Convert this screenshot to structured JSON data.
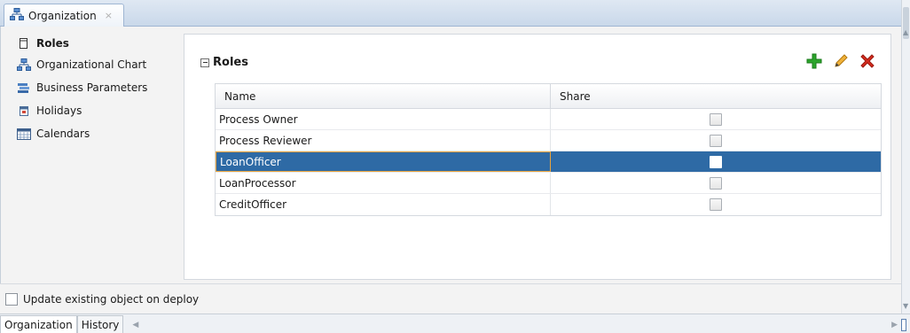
{
  "document_tab": {
    "label": "Organization",
    "close": "×"
  },
  "nav": {
    "items": [
      {
        "label": "Roles",
        "icon": "roles-icon",
        "active": true
      },
      {
        "label": "Organizational Chart",
        "icon": "org-chart-icon"
      },
      {
        "label": "Business Parameters",
        "icon": "business-parameters-icon"
      },
      {
        "label": "Holidays",
        "icon": "holidays-icon"
      },
      {
        "label": "Calendars",
        "icon": "calendars-icon"
      }
    ]
  },
  "section": {
    "title": "Roles",
    "actions": [
      {
        "name": "add",
        "icon": "plus-icon"
      },
      {
        "name": "edit",
        "icon": "pencil-icon"
      },
      {
        "name": "delete",
        "icon": "delete-x-icon"
      }
    ]
  },
  "table": {
    "columns": [
      "Name",
      "Share"
    ],
    "rows": [
      {
        "name": "Process Owner",
        "share": false
      },
      {
        "name": "Process Reviewer",
        "share": false
      },
      {
        "name": "LoanOfficer",
        "share": false,
        "selected": true
      },
      {
        "name": "LoanProcessor",
        "share": false
      },
      {
        "name": "CreditOfficer",
        "share": false
      }
    ]
  },
  "deploy": {
    "label": "Update existing object on deploy",
    "checked": false
  },
  "bottom_tabs": [
    {
      "label": "Organization",
      "active": true
    },
    {
      "label": "History"
    }
  ],
  "colors": {
    "selection": "#2e6aa5",
    "focus_border": "#e8a33d",
    "add_icon": "#2ca52c",
    "edit_icon": "#e39b1a",
    "delete_icon": "#d52b1e"
  }
}
